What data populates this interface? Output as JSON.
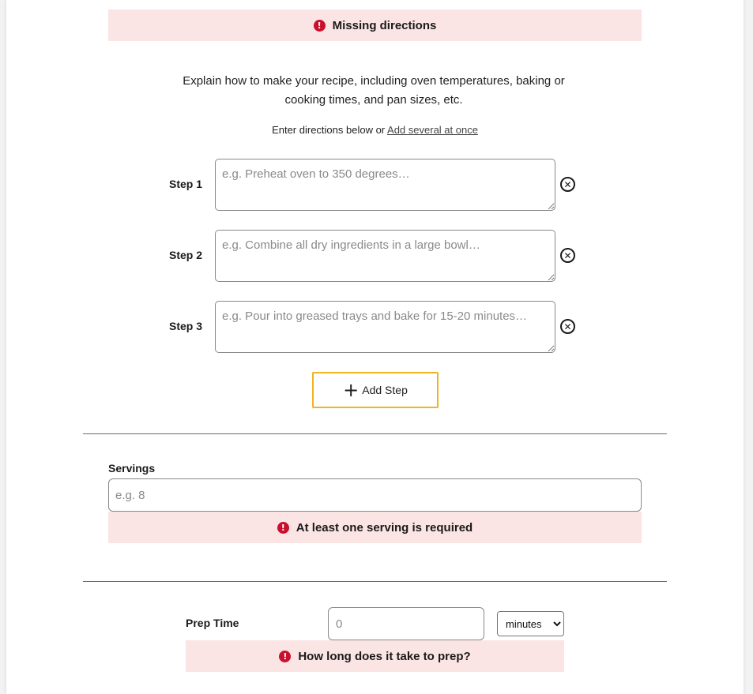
{
  "directions": {
    "error_banner": "Missing directions",
    "explain_text": "Explain how to make your recipe, including oven temperatures, baking or cooking times, and pan sizes, etc.",
    "enter_prefix": "Enter directions below or ",
    "add_several_link": "Add several at once",
    "steps": [
      {
        "label": "Step 1",
        "placeholder": "e.g. Preheat oven to 350 degrees…"
      },
      {
        "label": "Step 2",
        "placeholder": "e.g. Combine all dry ingredients in a large bowl…"
      },
      {
        "label": "Step 3",
        "placeholder": "e.g. Pour into greased trays and bake for 15-20 minutes…"
      }
    ],
    "remove_icon": "remove-circle-x-icon",
    "add_step_label": "Add Step",
    "add_step_icon": "plus-icon"
  },
  "servings": {
    "label": "Servings",
    "placeholder": "e.g. 8",
    "error": "At least one serving is required"
  },
  "prep_time": {
    "label": "Prep Time",
    "placeholder": "0",
    "unit_selected": "minutes",
    "error": "How long does it take to prep?"
  },
  "colors": {
    "error_bg": "#fbe4e4",
    "error_icon": "#c8102e",
    "accent_border": "#f0b323"
  }
}
